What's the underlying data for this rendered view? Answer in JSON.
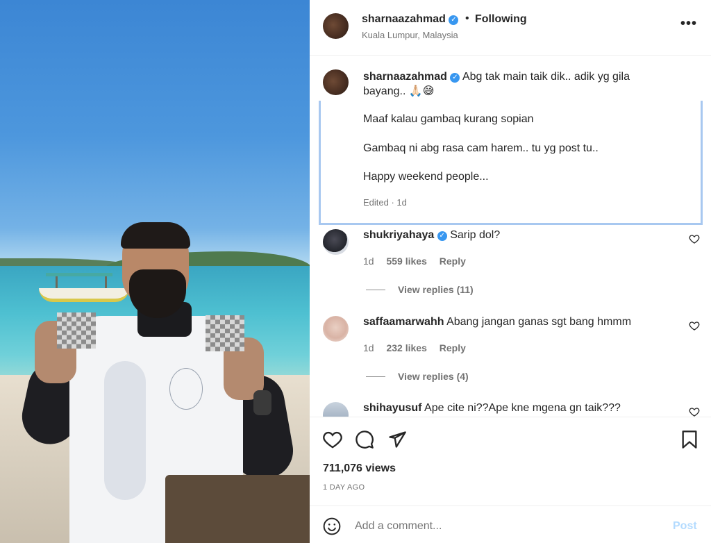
{
  "post": {
    "username": "sharnaazahmad",
    "follow_status": "Following",
    "separator": "•",
    "location": "Kuala Lumpur, Malaysia",
    "more_icon": "more-horizontal-icon",
    "more_glyph": "•••"
  },
  "caption": {
    "username": "sharnaazahmad",
    "text_line1": "Abg tak main taik dik.. adik yg gila bayang.. 🙏🏻😅",
    "para2": "Maaf kalau gambaq kurang sopian",
    "para3": "Gambaq ni abg rasa cam harem.. tu yg post tu..",
    "para4": "Happy weekend people...",
    "meta": "Edited · 1d"
  },
  "comments": [
    {
      "username": "shukriyahaya",
      "verified": true,
      "text": "Sarip dol?",
      "time": "1d",
      "likes": "559 likes",
      "reply": "Reply",
      "view_replies": "View replies (11)"
    },
    {
      "username": "saffaamarwahh",
      "verified": false,
      "text": "Abang jangan ganas sgt bang hmmm",
      "time": "1d",
      "likes": "232 likes",
      "reply": "Reply",
      "view_replies": "View replies (4)"
    },
    {
      "username": "shihayusuf",
      "verified": false,
      "text": "Ape cite ni??Ape kne mgena gn taik???"
    }
  ],
  "actions": {
    "views": "711,076 views",
    "date": "1 DAY AGO"
  },
  "add_comment": {
    "placeholder": "Add a comment...",
    "post_label": "Post"
  },
  "colors": {
    "verified": "#3897f0",
    "post_disabled": "#b3dbff",
    "caption_highlight": "#a8c8f0"
  },
  "verified_glyph": "✓"
}
